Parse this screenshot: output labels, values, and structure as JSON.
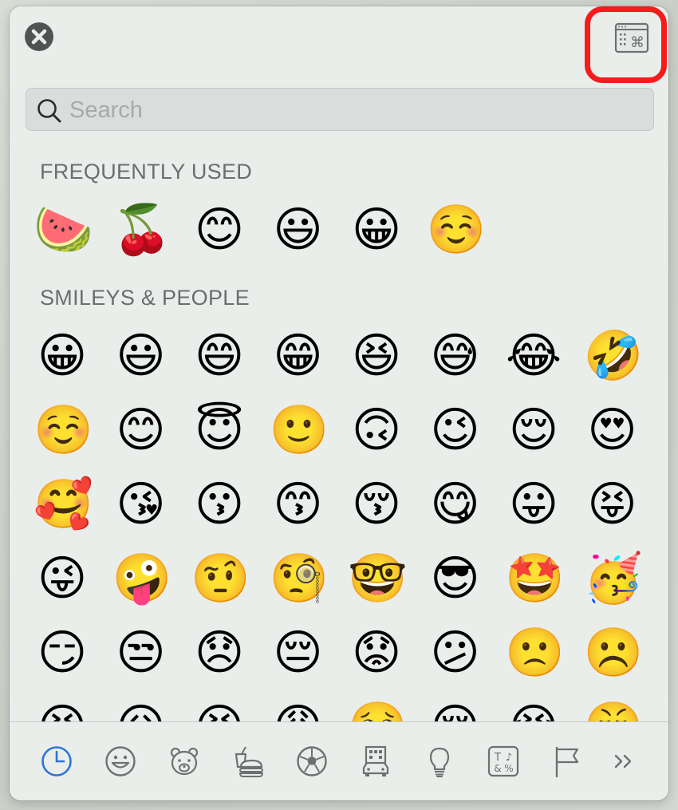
{
  "search": {
    "placeholder": "Search",
    "value": ""
  },
  "sections": [
    {
      "title": "FREQUENTLY USED",
      "emojis": [
        "🍉",
        "🍒",
        "😊",
        "😃",
        "😀",
        "☺️"
      ]
    },
    {
      "title": "SMILEYS & PEOPLE",
      "emojis": [
        "😀",
        "😃",
        "😄",
        "😁",
        "😆",
        "😅",
        "😂",
        "🤣",
        "☺️",
        "😊",
        "😇",
        "🙂",
        "🙃",
        "😉",
        "😌",
        "😍",
        "🥰",
        "😘",
        "😗",
        "😙",
        "😚",
        "😋",
        "😛",
        "😝",
        "😜",
        "🤪",
        "🤨",
        "🧐",
        "🤓",
        "😎",
        "🤩",
        "🥳",
        "😏",
        "😒",
        "😞",
        "😔",
        "😟",
        "😕",
        "🙁",
        "☹️",
        "😣",
        "😖",
        "😫",
        "😩",
        "🥺",
        "😢",
        "😭",
        "😤"
      ]
    }
  ],
  "toolbar": {
    "close_icon": "close-icon",
    "viewer_icon": "character-viewer-icon",
    "highlight_color": "#f41c1c"
  },
  "tabs": [
    {
      "name": "frequently-used",
      "icon": "clock-icon",
      "active": true,
      "color": "#2f73d9"
    },
    {
      "name": "smileys-people",
      "icon": "smiley-icon"
    },
    {
      "name": "animals-nature",
      "icon": "bear-icon"
    },
    {
      "name": "food-drink",
      "icon": "food-icon"
    },
    {
      "name": "activity",
      "icon": "soccer-ball-icon"
    },
    {
      "name": "travel-places",
      "icon": "building-car-icon"
    },
    {
      "name": "objects",
      "icon": "lightbulb-icon"
    },
    {
      "name": "symbols",
      "icon": "symbols-icon"
    },
    {
      "name": "flags",
      "icon": "flag-icon"
    },
    {
      "name": "more",
      "icon": "chevron-double-right-icon"
    }
  ]
}
